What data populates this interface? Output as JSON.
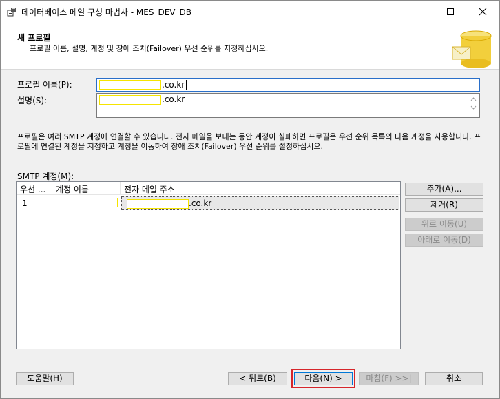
{
  "window": {
    "title": "데이터베이스 메일 구성 마법사 - MES_DEV_DB"
  },
  "header": {
    "title": "새 프로필",
    "subtitle": "프로필 이름, 설명, 계정 및 장애 조치(Failover) 우선 순위를 지정하십시오."
  },
  "form": {
    "profile_name_label": "프로필 이름(P):",
    "profile_name_suffix": ".co.kr",
    "description_label": "설명(S):",
    "description_suffix": ".co.kr"
  },
  "info_text": "프로필은 여러 SMTP 계정에 연결할 수 있습니다. 전자 메일을 보내는 동안 계정이 실패하면 프로필은 우선 순위 목록의 다음 계정을 사용합니다. 프로필에 연결된 계정을 지정하고 계정을 이동하여 장애 조치(Failover) 우선 순위를 설정하십시오.",
  "smtp": {
    "label": "SMTP 계정(M):",
    "columns": [
      "우선 ...",
      "계정 이름",
      "전자 메일 주소"
    ],
    "rows": [
      {
        "priority": "1",
        "email_suffix": ".co.kr"
      }
    ]
  },
  "side_buttons": {
    "add": "추가(A)...",
    "remove": "제거(R)",
    "move_up": "위로 이동(U)",
    "move_down": "아래로 이동(D)"
  },
  "footer_buttons": {
    "help": "도움말(H)",
    "back": "< 뒤로(B)",
    "next": "다음(N) >",
    "finish": "마침(F) >>|",
    "cancel": "취소"
  },
  "colors": {
    "redaction": "#f5e400",
    "highlight": "#d6262b",
    "focus": "#2a6fc9"
  }
}
